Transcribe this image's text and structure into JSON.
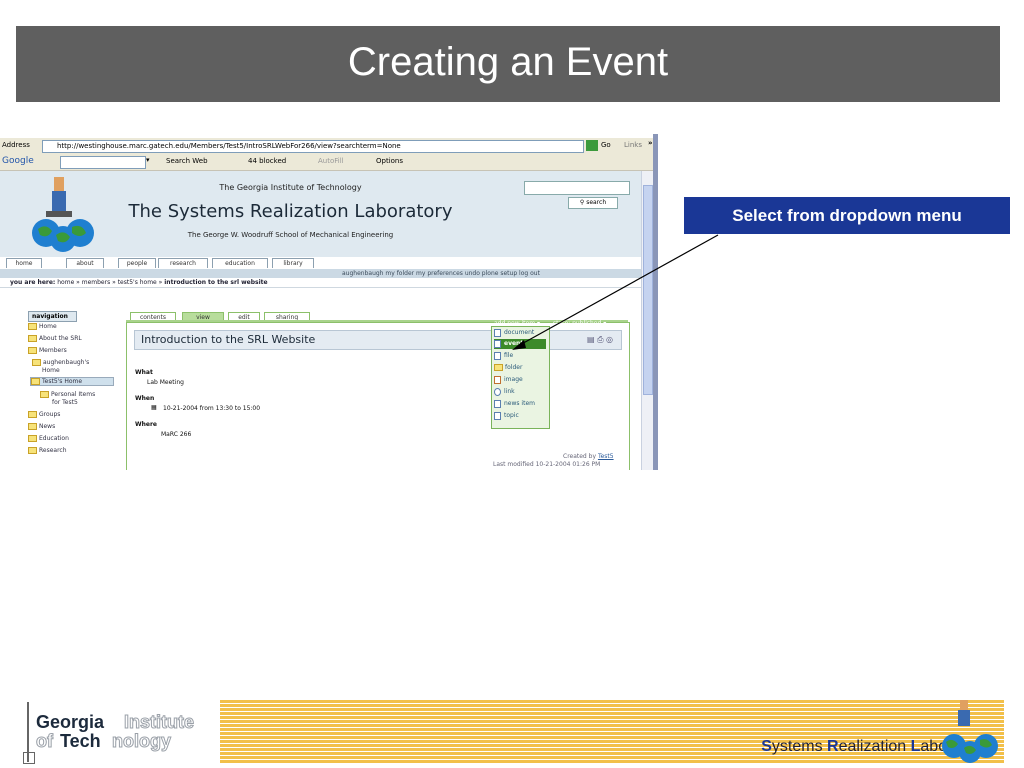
{
  "slide": {
    "title": "Creating an Event",
    "callout": "Select from dropdown menu"
  },
  "browser": {
    "address_label": "Address",
    "address_value": "http://westinghouse.marc.gatech.edu/Members/Test5/IntroSRLWebFor266/view?searchterm=None",
    "go_label": "Go",
    "links_label": "Links",
    "google_label": "Google",
    "search_web": "Search Web",
    "blocked": "44 blocked",
    "autofill": "AutoFill",
    "options": "Options"
  },
  "site": {
    "institute": "The Georgia Institute of Technology",
    "lab_name": "The Systems Realization Laboratory",
    "school": "The George W. Woodruff School of Mechanical Engineering",
    "search_button": "search",
    "portal_tabs": [
      "home",
      "about",
      "people",
      "research",
      "education",
      "library"
    ],
    "user_actions": "aughenbaugh   my folder   my preferences   undo   plone setup   log out",
    "breadcrumb_label": "you are here:",
    "breadcrumb_path": "home » members » test5's home »",
    "breadcrumb_current": "introduction to the srl website"
  },
  "navigation": {
    "title": "navigation",
    "items": [
      "Home",
      "About the SRL",
      "Members",
      "aughenbaugh's",
      "Home",
      "Test5's Home",
      "Personal Items",
      "for Test5",
      "Groups",
      "News",
      "Education",
      "Research"
    ]
  },
  "content": {
    "tabs": [
      "contents",
      "view",
      "edit",
      "sharing"
    ],
    "add_new_item": "add new item ▾",
    "state": "state: published ▾",
    "title": "Introduction to the SRL Website",
    "what_label": "What",
    "what_value": "Lab Meeting",
    "when_label": "When",
    "when_value": "10-21-2004 from 13:30 to 15:00",
    "where_label": "Where",
    "where_value": "MaRC 266",
    "created_by_label": "Created by",
    "created_by_user": "Test5",
    "last_modified": "Last modified 10-21-2004 01:26 PM"
  },
  "dropdown": {
    "items": [
      "document",
      "event",
      "file",
      "folder",
      "image",
      "link",
      "news item",
      "topic"
    ],
    "selected": "event"
  },
  "footer": {
    "georgia": "Georgia",
    "institute": "Institute",
    "of": "of",
    "tech": "Tech",
    "nology": "nology",
    "lab_s": "S",
    "lab_ystems": "ystems ",
    "lab_r": "R",
    "lab_ealization": "ealization ",
    "lab_l": "L",
    "lab_aboratory": "aboratory"
  }
}
